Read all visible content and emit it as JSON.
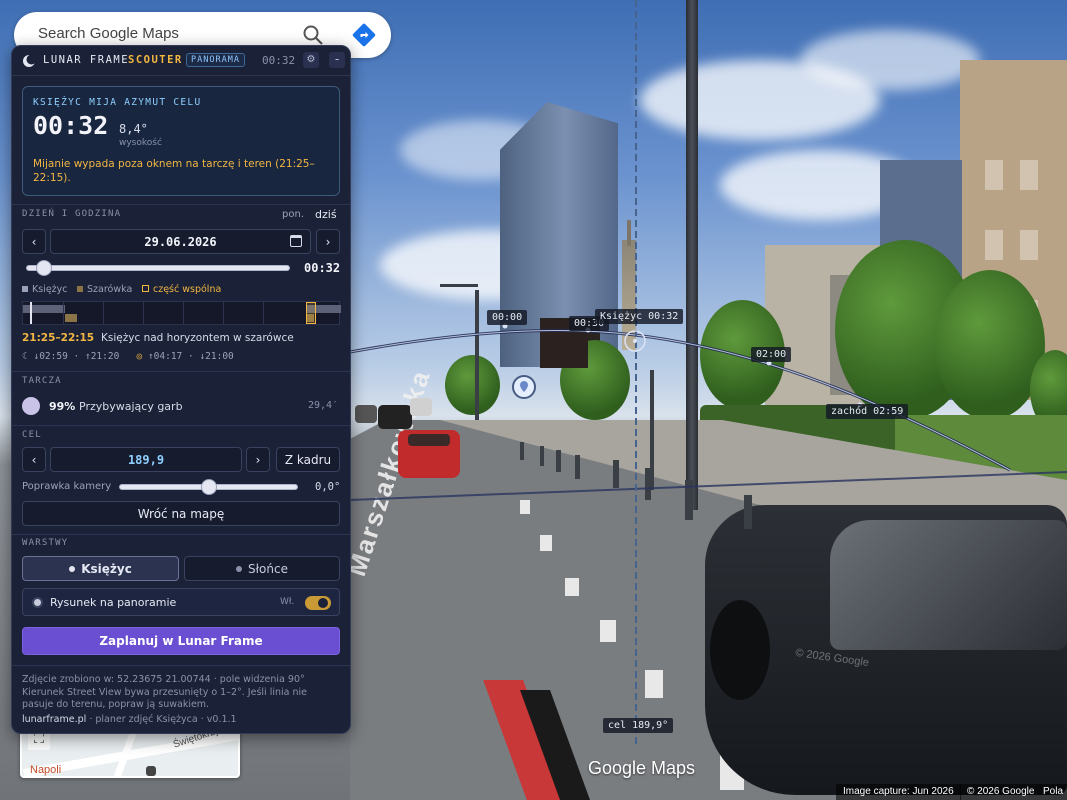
{
  "search": {
    "placeholder": "Search Google Maps"
  },
  "panel": {
    "brand": "LUNAR FRAME",
    "brand_accent": "SCOUTER",
    "mode_badge": "PANORAMA",
    "header_time": "00:32",
    "alert": {
      "title": "KSIĘŻYC MIJA AZYMUT CELU",
      "time": "00:32",
      "altitude": "8,4°",
      "altitude_label": "wysokość",
      "warning": "Mijanie wypada poza oknem na tarczę i teren (21:25–22:15)."
    },
    "datetime": {
      "section": "DZIEŃ I GODZINA",
      "weekday": "pon.",
      "today_link": "dziś",
      "date": "29.06.2026",
      "time": "00:32",
      "slider_position": 0.04
    },
    "legend": {
      "moon": "Księżyc",
      "twilight": "Szarówka",
      "common": "część wspólna"
    },
    "window_text": {
      "range": "21:25–22:15",
      "desc": "Księżyc nad horyzontem w szarówce"
    },
    "times": {
      "moonset": "↓02:59",
      "moonrise": "↑21:20",
      "sunrise": "↑04:17",
      "sunset": "↓21:00"
    },
    "disc": {
      "section": "TARCZA",
      "illumination": "99%",
      "phase": "Przybywający garb",
      "size": "29,4′"
    },
    "target": {
      "section": "CEL",
      "azimuth": "189,9",
      "from_frame": "Z kadru",
      "camera_correction_label": "Poprawka kamery",
      "camera_correction": "0,0°",
      "correction_position": 0.5,
      "back_to_map": "Wróć na mapę"
    },
    "layers": {
      "section": "WARSTWY",
      "moon": "Księżyc",
      "sun": "Słońce",
      "drawing": "Rysunek na panoramie",
      "drawing_state": "Wł."
    },
    "plan_button": "Zaplanuj w Lunar Frame",
    "footer": {
      "line1": "Zdjęcie zrobiono w: 52.23675 21.00744 · pole widzenia 90°",
      "line2": "Kierunek Street View bywa przesunięty o 1–2°. Jeśli linia nie pasuje do terenu, popraw ją suwakiem.",
      "site": "lunarframe.pl",
      "tagline": "· planer zdjęć Księżyca · v0.1.1"
    }
  },
  "overlay": {
    "labels": {
      "t0000": "00:00",
      "t0030": "00:30",
      "moon_now": "Księżyc 00:32",
      "t0200": "02:00",
      "set": "zachód 02:59",
      "target": "cel 189,9°"
    },
    "street_name": "Marszałkowska",
    "watermark": "Google Maps",
    "copyright_faint": "© 2026 Google",
    "credits": {
      "capture": "Image capture: Jun 2026",
      "copyright": "© 2026 Google",
      "extra": "Pola"
    }
  },
  "minimap": {
    "street": "Świętokrzyska",
    "poi": "Napoli"
  },
  "colors": {
    "accent": "#f2b642",
    "primary": "#6b4fd3",
    "panel_bg": "#1b2136",
    "moon_bar": "#c7cbd9",
    "twilight": "#8a7346"
  }
}
